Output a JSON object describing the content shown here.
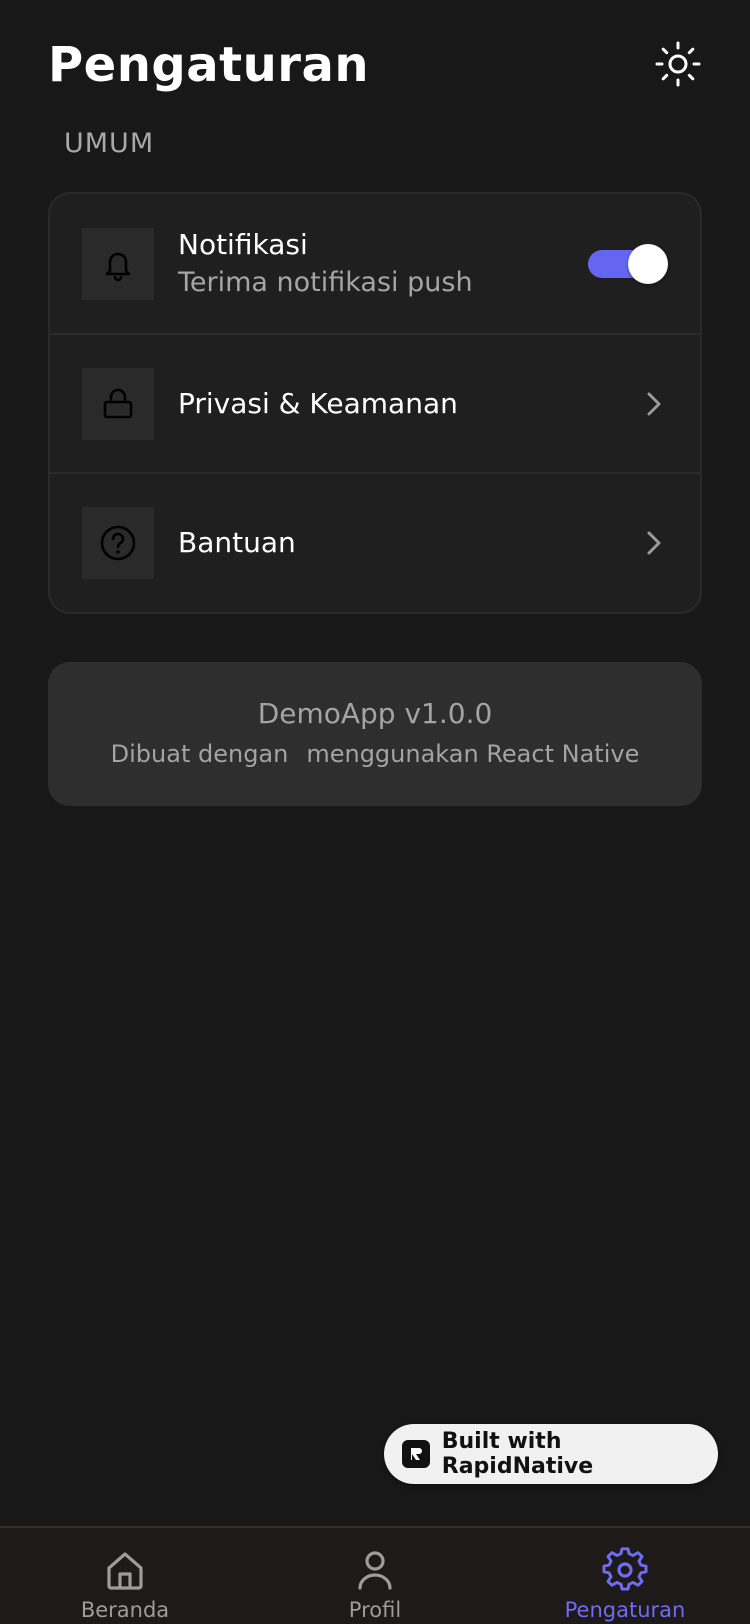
{
  "header": {
    "title": "Pengaturan"
  },
  "section": {
    "label": "UMUM"
  },
  "settings": {
    "notifications": {
      "title": "Notifikasi",
      "subtitle": "Terima notifikasi push",
      "enabled": true
    },
    "privacy": {
      "title": "Privasi & Keamanan"
    },
    "help": {
      "title": "Bantuan"
    }
  },
  "about": {
    "app_version": "DemoApp v1.0.0",
    "built_prefix": "Dibuat dengan",
    "built_suffix": "menggunakan React Native"
  },
  "badge": {
    "label": "Built with RapidNative"
  },
  "tabs": [
    {
      "label": "Beranda",
      "icon": "home-icon",
      "active": false
    },
    {
      "label": "Profil",
      "icon": "user-icon",
      "active": false
    },
    {
      "label": "Pengaturan",
      "icon": "gear-icon",
      "active": true
    }
  ],
  "colors": {
    "background": "#181818",
    "accent": "#6466f1",
    "card": "#1f1f1f",
    "muted_text": "#a5a5a5"
  }
}
